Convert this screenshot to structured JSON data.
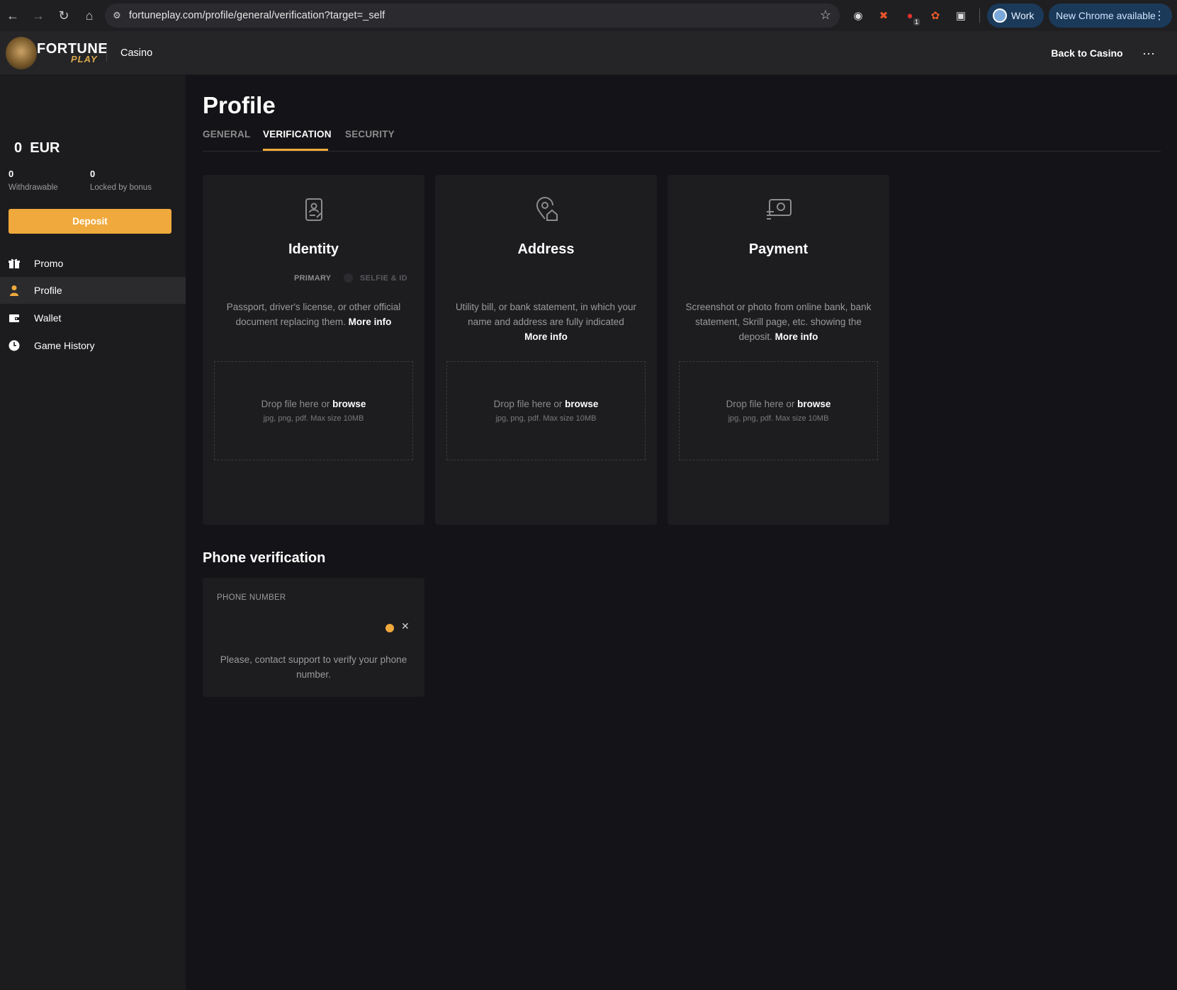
{
  "browser": {
    "url": "fortuneplay.com/profile/general/verification?target=_self",
    "profile_label": "Work",
    "update_label": "New Chrome available",
    "extension_badge": "1"
  },
  "header": {
    "logo_text": "FORTUNE",
    "logo_sub": "PLAY",
    "casino_link": "Casino",
    "back_button": "Back to Casino",
    "more_button": "···"
  },
  "sidebar": {
    "balance": "0  EUR",
    "withdrawable_value": "0",
    "withdrawable_label": "Withdrawable",
    "locked_value": "0",
    "locked_label": "Locked by bonus",
    "deposit_button": "Deposit",
    "menu": [
      {
        "label": "Promo",
        "icon": "gift-icon"
      },
      {
        "label": "Profile",
        "icon": "user-icon",
        "active": true
      },
      {
        "label": "Wallet",
        "icon": "wallet-icon"
      },
      {
        "label": "Game History",
        "icon": "clock-icon"
      }
    ]
  },
  "main": {
    "title": "Profile",
    "tabs": [
      {
        "label": "GENERAL"
      },
      {
        "label": "VERIFICATION",
        "active": true
      },
      {
        "label": "SECURITY"
      }
    ],
    "cards": [
      {
        "title": "Identity",
        "icon": "id-document-icon",
        "sub_primary": "PRIMARY",
        "sub_secondary": "SELFIE & ID",
        "desc": "Passport, driver's license, or other official document replacing them.",
        "more": "More info",
        "drop_text": "Drop file here or",
        "browse": "browse",
        "drop_hint": "jpg, png, pdf. Max size 10MB"
      },
      {
        "title": "Address",
        "icon": "location-home-icon",
        "desc": "Utility bill, or bank statement, in which your name and address are fully indicated",
        "more": "More info",
        "drop_text": "Drop file here or",
        "browse": "browse",
        "drop_hint": "jpg, png, pdf. Max size 10MB"
      },
      {
        "title": "Payment",
        "icon": "payment-screen-icon",
        "desc": "Screenshot or photo from online bank, bank statement, Skrill page, etc. showing the deposit.",
        "more": "More info",
        "drop_text": "Drop file here or",
        "browse": "browse",
        "drop_hint": "jpg, png, pdf. Max size 10MB"
      }
    ],
    "phone": {
      "title": "Phone verification",
      "label": "PHONE NUMBER",
      "message": "Please, contact support to verify your phone number."
    }
  },
  "colors": {
    "accent": "#f0a93c",
    "background": "#141418",
    "card": "#1d1d20"
  }
}
